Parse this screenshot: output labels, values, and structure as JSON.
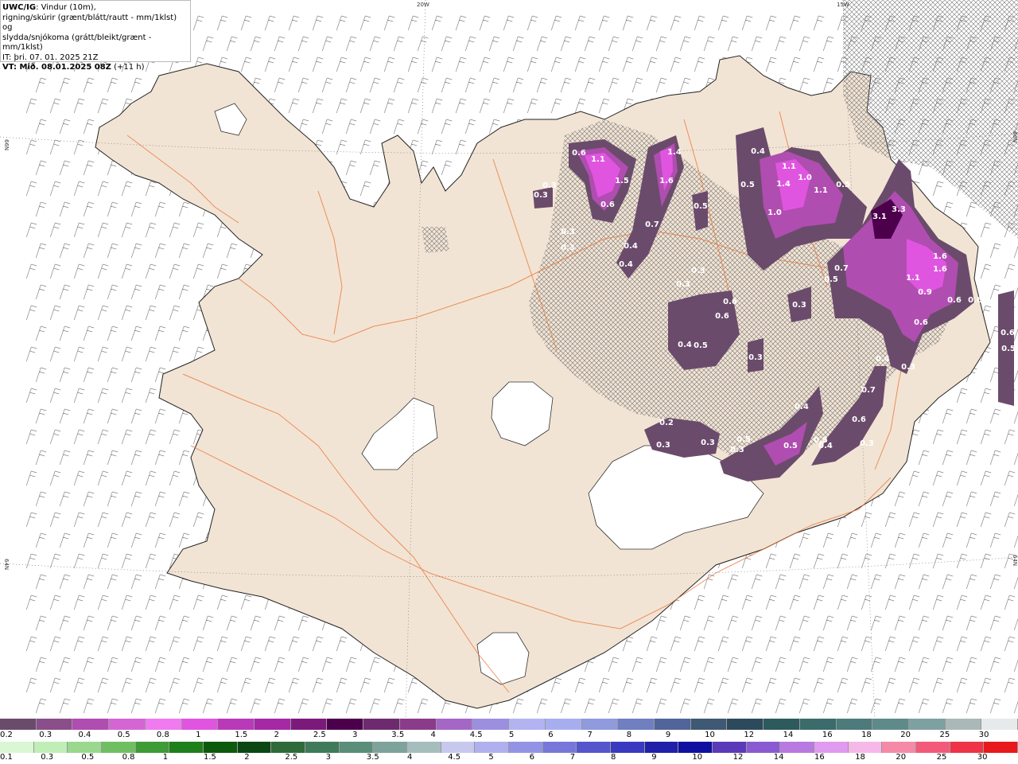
{
  "header": {
    "model": "UWC/IG",
    "line1": ": Vindur (10m),",
    "line2": "rigning/skúrir (grænt/blátt/rautt - mm/1klst) og",
    "line3": "slydda/snjókoma (grátt/bleikt/grænt - mm/1klst)",
    "init": "IT: þri. 07. 01. 2025 21Z",
    "valid": "VT: Mið. 08.01.2025 08Z",
    "lead": " (+11 h)"
  },
  "grid_labels": {
    "top_20w": "20W",
    "top_15w": "15W",
    "left_66n": "66N",
    "left_64n": "64N",
    "right_66n": "66N",
    "right_64n": "64N"
  },
  "precip_labels": [
    {
      "v": "0.6"
    },
    {
      "v": "1.1"
    },
    {
      "v": "1.5"
    },
    {
      "v": "0.6"
    },
    {
      "v": "1.4"
    },
    {
      "v": "1.6"
    },
    {
      "v": "0.3"
    },
    {
      "v": "0.3"
    },
    {
      "v": "0.3"
    },
    {
      "v": "0.3"
    },
    {
      "v": "0.4"
    },
    {
      "v": "0.4"
    },
    {
      "v": "0.7"
    },
    {
      "v": "0.5"
    },
    {
      "v": "0.4"
    },
    {
      "v": "1.1"
    },
    {
      "v": "1.4"
    },
    {
      "v": "1.0"
    },
    {
      "v": "1.1"
    },
    {
      "v": "0.5"
    },
    {
      "v": "1.0"
    },
    {
      "v": "0.5"
    },
    {
      "v": "3.1"
    },
    {
      "v": "3.3"
    },
    {
      "v": "1.6"
    },
    {
      "v": "1.6"
    },
    {
      "v": "1.1"
    },
    {
      "v": "0.9"
    },
    {
      "v": "0.5"
    },
    {
      "v": "0.7"
    },
    {
      "v": "0.6"
    },
    {
      "v": "0.6"
    },
    {
      "v": "0.6"
    },
    {
      "v": "0.6"
    },
    {
      "v": "0.3"
    },
    {
      "v": "0.3"
    },
    {
      "v": "0.6"
    },
    {
      "v": "0.6"
    },
    {
      "v": "0.4"
    },
    {
      "v": "0.5"
    },
    {
      "v": "0.3"
    },
    {
      "v": "0.3"
    },
    {
      "v": "0.4"
    },
    {
      "v": "0.3"
    },
    {
      "v": "0.5"
    },
    {
      "v": "0.5"
    },
    {
      "v": "0.4"
    },
    {
      "v": "0.7"
    },
    {
      "v": "0.6"
    },
    {
      "v": "0.4"
    },
    {
      "v": "0.5"
    },
    {
      "v": "0.3"
    },
    {
      "v": "0.2"
    },
    {
      "v": "0.3"
    },
    {
      "v": "0.3"
    },
    {
      "v": "0.5"
    },
    {
      "v": "0.3"
    }
  ],
  "colorbar_top": {
    "colors": [
      "#6b4b6b",
      "#8a4f8a",
      "#b04db0",
      "#d466d4",
      "#f07af0",
      "#e055e0",
      "#b93ab9",
      "#a528a5",
      "#7c1a7c",
      "#4c004c",
      "#6e2a6e",
      "#8a3c8a",
      "#a567c5",
      "#9c8fe0",
      "#b3b3f2",
      "#a7aef0",
      "#8f9bdc",
      "#6f7fc0",
      "#52659a",
      "#3f5873",
      "#2c4a5c",
      "#2d5a5c",
      "#3b6b6b",
      "#4d7a7a",
      "#5f8a8a",
      "#7fa0a0",
      "#aab8b8",
      "#e7eaea"
    ],
    "ticks": [
      "0.2",
      "0.3",
      "0.4",
      "0.5",
      "0.8",
      "1",
      "1.5",
      "2",
      "2.5",
      "3",
      "3.5",
      "4",
      "4.5",
      "5",
      "6",
      "7",
      "8",
      "9",
      "10",
      "12",
      "14",
      "16",
      "18",
      "20",
      "25",
      "30"
    ]
  },
  "colorbar_bottom": {
    "colors": [
      "#d9f7d2",
      "#bfeeb6",
      "#9ad88d",
      "#6fbf62",
      "#3f9b36",
      "#1f7f1a",
      "#0d5a0d",
      "#0b4712",
      "#2f6a3a",
      "#3f7a5a",
      "#5a8e7a",
      "#7da39a",
      "#a6bdbd",
      "#c8c8ee",
      "#b0b0ee",
      "#9393e5",
      "#7777d9",
      "#5555cc",
      "#3a3ac0",
      "#2020a8",
      "#1010a0",
      "#5a3ab8",
      "#8a5bd0",
      "#b879e0",
      "#e09aef",
      "#f6b8e8",
      "#f58aa6",
      "#f35a7a",
      "#ef3245",
      "#e8191a"
    ],
    "ticks": [
      "0.1",
      "0.3",
      "0.5",
      "0.8",
      "1",
      "1.5",
      "2",
      "2.5",
      "3",
      "3.5",
      "4",
      "4.5",
      "5",
      "6",
      "7",
      "8",
      "9",
      "10",
      "12",
      "14",
      "16",
      "18",
      "20",
      "25",
      "30"
    ]
  }
}
